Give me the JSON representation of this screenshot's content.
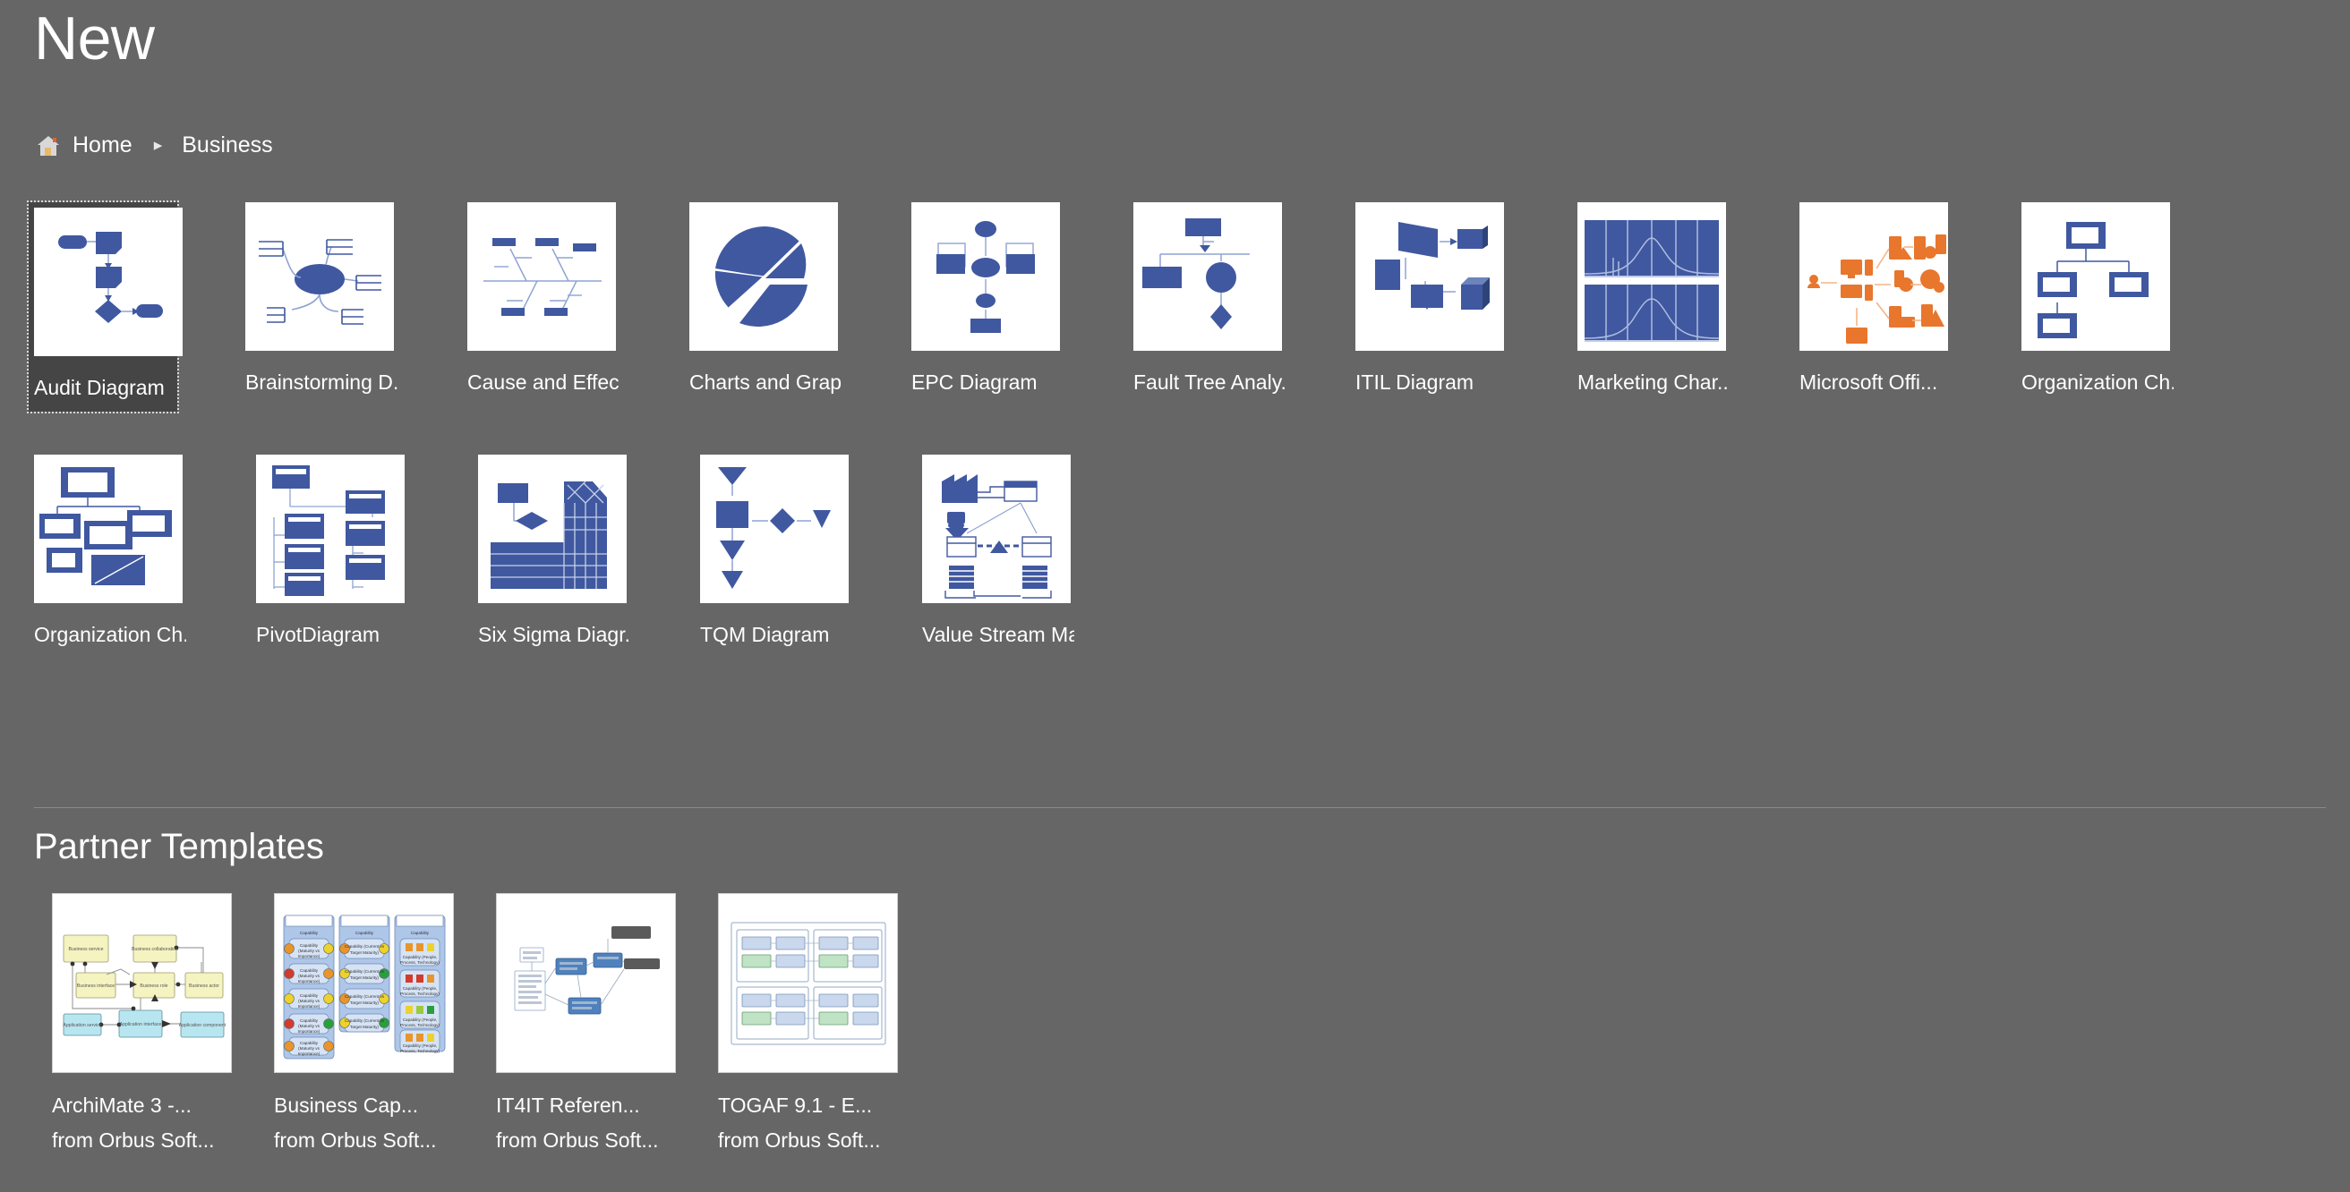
{
  "header": {
    "title": "New",
    "breadcrumb": {
      "home_label": "Home",
      "separator": "▸",
      "current_label": "Business",
      "home_icon": "home-icon"
    }
  },
  "colors": {
    "background": "#666666",
    "selected_tile": "#454545",
    "thumb_background": "#ffffff",
    "accent_blue": "#4058A0",
    "accent_blue_light": "#8FA3D4",
    "accent_orange": "#E8762C",
    "text": "#ffffff",
    "divider": "#8a8a8a"
  },
  "templates": {
    "row1": [
      {
        "label": "Audit Diagram",
        "art": "audit",
        "selected": true
      },
      {
        "label": "Brainstorming D...",
        "art": "brainstorm",
        "selected": false
      },
      {
        "label": "Cause and Effec...",
        "art": "cause",
        "selected": false
      },
      {
        "label": "Charts and Grap...",
        "art": "charts",
        "selected": false
      },
      {
        "label": "EPC Diagram",
        "art": "epc",
        "selected": false
      },
      {
        "label": "Fault Tree Analy...",
        "art": "fault",
        "selected": false
      },
      {
        "label": "ITIL Diagram",
        "art": "itil",
        "selected": false
      },
      {
        "label": "Marketing Char...",
        "art": "marketing",
        "selected": false
      },
      {
        "label": "Microsoft Offi...",
        "art": "msoffice",
        "selected": false
      },
      {
        "label": "Organization Ch...",
        "art": "orgchart1",
        "selected": false
      }
    ],
    "row2": [
      {
        "label": "Organization Ch...",
        "art": "orgchart2",
        "selected": false
      },
      {
        "label": "PivotDiagram",
        "art": "pivot",
        "selected": false
      },
      {
        "label": "Six Sigma Diagr...",
        "art": "sixsigma",
        "selected": false
      },
      {
        "label": "TQM Diagram",
        "art": "tqm",
        "selected": false
      },
      {
        "label": "Value Stream Map",
        "art": "vsm",
        "selected": false
      }
    ]
  },
  "partner_section": {
    "title": "Partner Templates",
    "items": [
      {
        "name": "ArchiMate 3 -...",
        "from": "from Orbus Soft...",
        "art": "archimate"
      },
      {
        "name": "Business Cap...",
        "from": "from Orbus Soft...",
        "art": "buscap"
      },
      {
        "name": "IT4IT Referen...",
        "from": "from Orbus Soft...",
        "art": "it4it"
      },
      {
        "name": "TOGAF 9.1 - E...",
        "from": "from Orbus Soft...",
        "art": "togaf"
      }
    ]
  }
}
